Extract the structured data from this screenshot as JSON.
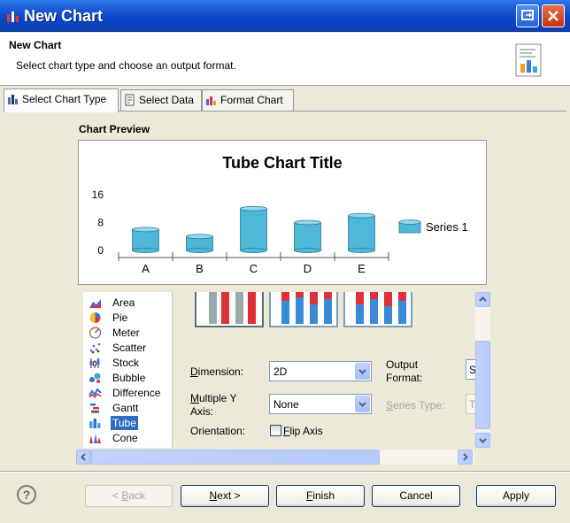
{
  "window": {
    "title": "New Chart"
  },
  "header": {
    "title": "New Chart",
    "description": "Select chart type and choose an output format."
  },
  "tabs": [
    {
      "label": "Select Chart Type",
      "icon": "chart-type-icon",
      "active": true
    },
    {
      "label": "Select Data",
      "icon": "data-icon",
      "active": false
    },
    {
      "label": "Format Chart",
      "icon": "format-chart-icon",
      "active": false
    }
  ],
  "preview": {
    "label": "Chart Preview",
    "chart_data": {
      "type": "bar",
      "title": "Tube Chart Title",
      "categories": [
        "A",
        "B",
        "C",
        "D",
        "E"
      ],
      "series": [
        {
          "name": "Series 1",
          "values": [
            6,
            4,
            12,
            8,
            10
          ]
        }
      ],
      "yticks": [
        "0",
        "8",
        "16"
      ],
      "ylim": [
        0,
        16
      ],
      "legend": "right",
      "colors": {
        "bar": "#4fb8d8",
        "bar_top": "#8fd8ee"
      }
    }
  },
  "type_list": {
    "items": [
      {
        "label": "Area",
        "icon": "area-chart-icon"
      },
      {
        "label": "Pie",
        "icon": "pie-chart-icon"
      },
      {
        "label": "Meter",
        "icon": "meter-chart-icon"
      },
      {
        "label": "Scatter",
        "icon": "scatter-chart-icon"
      },
      {
        "label": "Stock",
        "icon": "stock-chart-icon"
      },
      {
        "label": "Bubble",
        "icon": "bubble-chart-icon"
      },
      {
        "label": "Difference",
        "icon": "difference-chart-icon"
      },
      {
        "label": "Gantt",
        "icon": "gantt-chart-icon"
      },
      {
        "label": "Tube",
        "icon": "tube-chart-icon",
        "selected": true
      },
      {
        "label": "Cone",
        "icon": "cone-chart-icon"
      }
    ]
  },
  "form": {
    "dimension_label_key": "D",
    "dimension_label_rest": "imension:",
    "dimension_value": "2D",
    "multiple_y_label_key": "M",
    "multiple_y_label_rest": "ultiple Y",
    "multiple_y_label_line2": "Axis:",
    "multiple_y_value": "None",
    "orientation_label": "Orientation:",
    "flip_axis_label_key": "F",
    "flip_axis_label_rest": "lip Axis",
    "output_format_label_line1": "Output",
    "output_format_label_line2": "Format:",
    "output_format_value": "S",
    "series_type_label_key": "S",
    "series_type_label_rest": "eries Type:",
    "series_type_value": "T"
  },
  "buttons": {
    "back": {
      "key": "B",
      "pre": "< ",
      "rest": "ack"
    },
    "next": {
      "key": "N",
      "pre": "",
      "rest": "ext >"
    },
    "finish": {
      "key": "F",
      "pre": "",
      "rest": "inish"
    },
    "cancel": "Cancel",
    "apply": "Apply"
  },
  "help": "?",
  "colors": {
    "titlebar": "#0a46c8",
    "selection": "#316ac5",
    "tube": "#4fb8d8",
    "red": "#e0303a"
  }
}
